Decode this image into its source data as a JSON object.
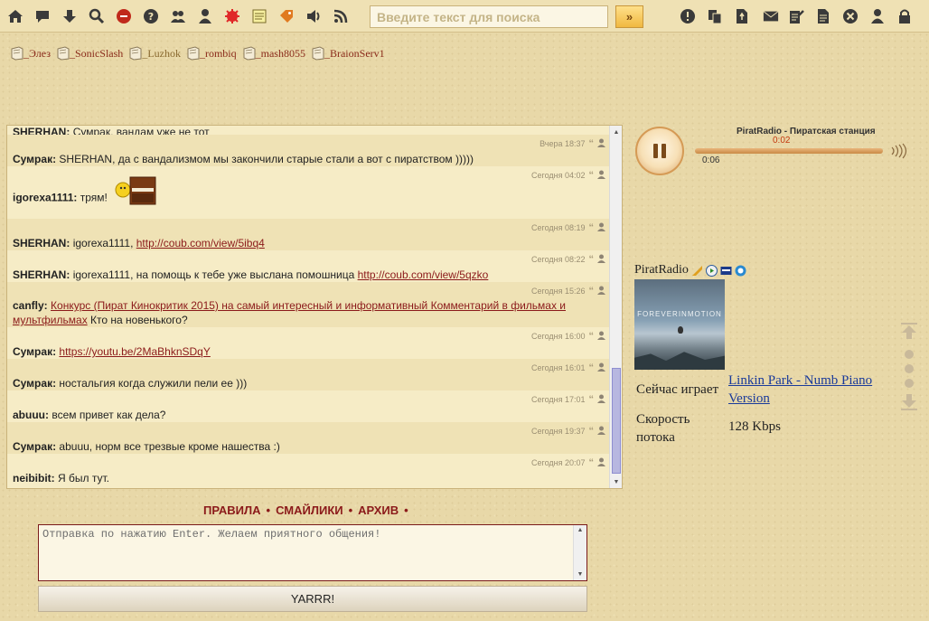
{
  "toolbar": {
    "icons_left": [
      "home-icon",
      "messages-icon",
      "download-icon",
      "search-icon",
      "stop-icon",
      "help-icon",
      "users-icon",
      "user-icon",
      "star-icon",
      "notepad-icon",
      "tag-icon",
      "sound-icon",
      "rss-icon"
    ],
    "search": {
      "placeholder": "Введите текст для поиска",
      "value": ""
    },
    "search_button": "»",
    "icons_right": [
      "info-icon",
      "copy-icon",
      "file-icon",
      "mail-icon",
      "edit-icon",
      "document-icon",
      "close-icon",
      "person-icon",
      "lock-icon"
    ]
  },
  "users": [
    {
      "name": "_Элез",
      "status": "online"
    },
    {
      "name": "_SonicSlash",
      "status": "online"
    },
    {
      "name": "_Luzhok",
      "status": "offline"
    },
    {
      "name": "_rombiq",
      "status": "online"
    },
    {
      "name": "_mash8055",
      "status": "online"
    },
    {
      "name": "_BraionServ1",
      "status": "online"
    }
  ],
  "chat": {
    "messages": [
      {
        "nick": "SHERHAN:",
        "text": "Сумрак, вандам уже не тот",
        "time": "",
        "link": "",
        "after_link": ""
      },
      {
        "nick": "Сумрак:",
        "text": "SHERHAN, да с вандализмом мы закончили старые стали а вот с пиратством )))))",
        "time": "Вчера 18:37",
        "link": "",
        "after_link": ""
      },
      {
        "nick": "igorexa1111:",
        "text": "трям!",
        "time": "Сегодня 04:02",
        "link": "",
        "after_link": ""
      },
      {
        "nick": "SHERHAN:",
        "text": "igorexa1111,",
        "time": "Сегодня 08:19",
        "link": "http://coub.com/view/5ibq4",
        "after_link": ""
      },
      {
        "nick": "SHERHAN:",
        "text": "igorexa1111, на помощь к тебе уже выслана помошница",
        "time": "Сегодня 08:22",
        "link": "http://coub.com/view/5qzko",
        "after_link": ""
      },
      {
        "nick": "canfly:",
        "text": "",
        "time": "Сегодня 15:26",
        "link": "Конкурс (Пират Кинокритик 2015) на самый интересный и информативный Комментарий в фильмах и мультфильмах",
        "after_link": "Кто на новенького?"
      },
      {
        "nick": "Сумрак:",
        "text": "",
        "time": "Сегодня 16:00",
        "link": "https://youtu.be/2MaBhknSDqY",
        "after_link": ""
      },
      {
        "nick": "Сумрак:",
        "text": "ностальгия когда служили пели ее )))",
        "time": "Сегодня 16:01",
        "link": "",
        "after_link": ""
      },
      {
        "nick": "abuuu:",
        "text": "всем привет как дела?",
        "time": "Сегодня 17:01",
        "link": "",
        "after_link": ""
      },
      {
        "nick": "Сумрак:",
        "text": "abuuu, норм все трезвые кроме нашества :)",
        "time": "Сегодня 19:37",
        "link": "",
        "after_link": ""
      },
      {
        "nick": "neibibit:",
        "text": "Я был тут.",
        "time": "Сегодня 20:07",
        "link": "",
        "after_link": ""
      }
    ]
  },
  "links": [
    "ПРАВИЛА",
    "СМАЙЛИКИ",
    "АРХИВ"
  ],
  "input": {
    "placeholder": "Отправка по нажатию Enter. Желаем приятного общения!",
    "value": ""
  },
  "send_button": "YARRR!",
  "radio": {
    "station": "PiratRadio - Пиратская станция",
    "progress_time": "0:02",
    "elapsed": "0:06",
    "name": "PiratRadio",
    "cover_text": "FOREVERINMOTION",
    "now_playing_label": "Сейчас играет",
    "now_playing": "Linkin Park - Numb Piano Version",
    "bitrate_label": "Скорость потока",
    "bitrate": "128 Kbps"
  }
}
